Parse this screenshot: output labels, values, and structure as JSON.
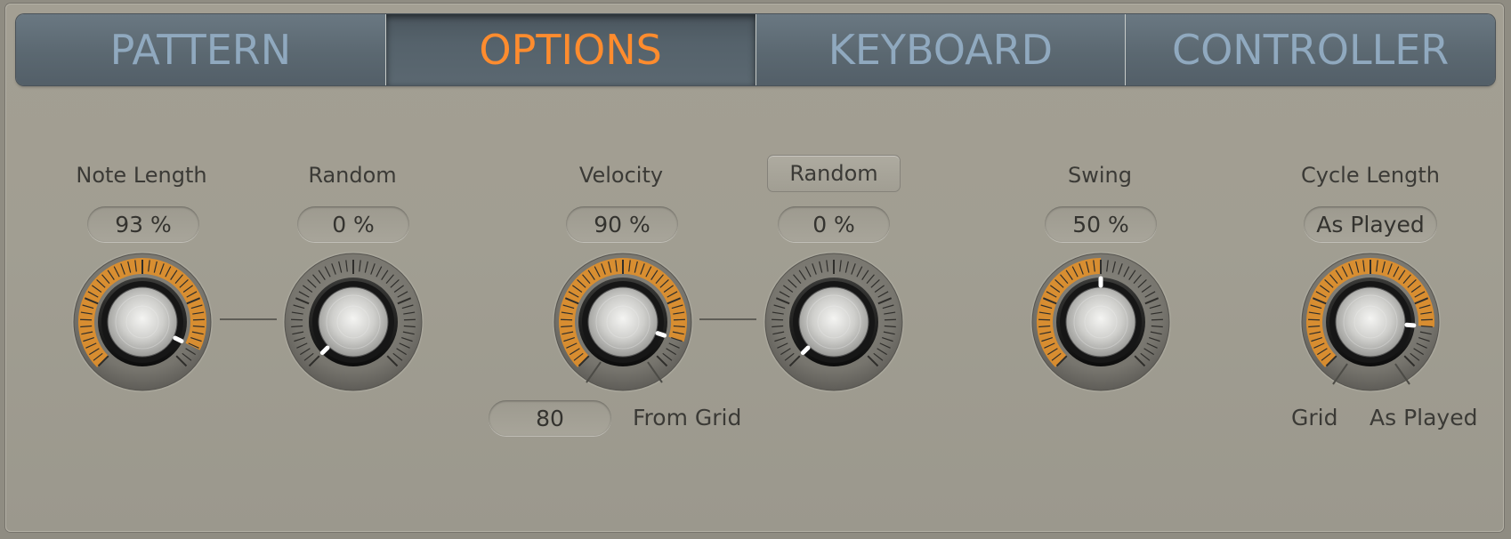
{
  "tabs": [
    {
      "label": "PATTERN",
      "active": false
    },
    {
      "label": "OPTIONS",
      "active": true
    },
    {
      "label": "KEYBOARD",
      "active": false
    },
    {
      "label": "CONTROLLER",
      "active": false
    }
  ],
  "colors": {
    "accent_active": "#ff8c2e",
    "tab_text": "#90a9bf",
    "tab_bg": "#5b6871",
    "knob_arc": "#e2902a",
    "panel_bg": "#a19e92"
  },
  "controls": {
    "note_length": {
      "label": "Note Length",
      "value": "93 %",
      "level": 0.93
    },
    "note_length_random": {
      "label": "Random",
      "value": "0 %",
      "level": 0
    },
    "velocity": {
      "label": "Velocity",
      "value": "90 %",
      "level": 0.9,
      "range_value": "80",
      "range_label": "From Grid"
    },
    "velocity_random": {
      "label": "Random",
      "value": "0 %",
      "level": 0
    },
    "swing": {
      "label": "Swing",
      "value": "50 %",
      "level": 0.5
    },
    "cycle_length": {
      "label": "Cycle Length",
      "value": "As Played",
      "level": 0.85,
      "min_label": "Grid",
      "max_label": "As Played"
    }
  },
  "icons": [
    "rotary-knob",
    "connector-line"
  ]
}
